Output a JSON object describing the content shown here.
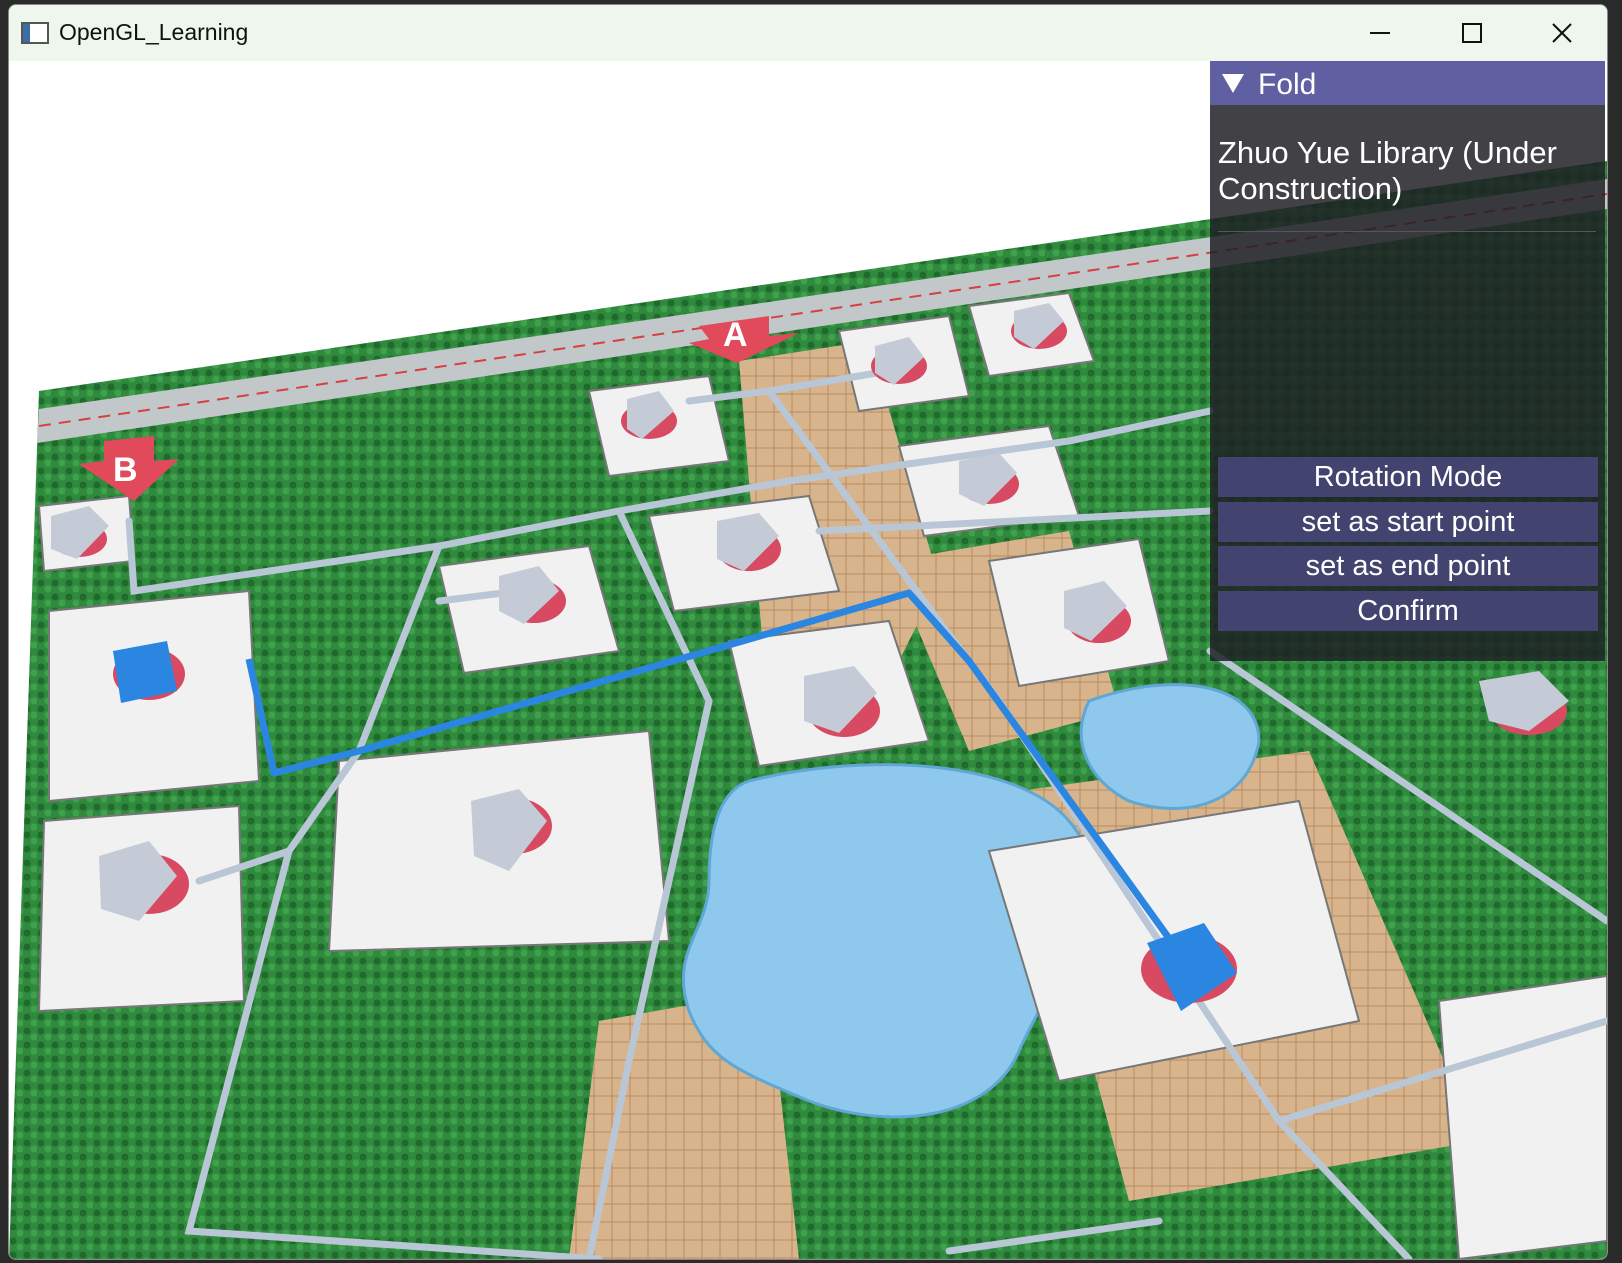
{
  "window": {
    "title": "OpenGL_Learning",
    "app_icon": "opengl-app-icon",
    "controls": [
      "minimize-icon",
      "maximize-icon",
      "close-icon"
    ]
  },
  "map": {
    "entrance_a": "A",
    "entrance_b": "B",
    "route_color": "#2a86e0",
    "road_color": "#b9c6d6",
    "water_color": "#8ec8ec",
    "grass_color": "#2f8a3e"
  },
  "panel": {
    "header_label": "Fold",
    "header_color": "#5f5fa2",
    "selected_place": "Zhuo Yue Library (Under Construction)",
    "buttons": {
      "rotation_mode": "Rotation Mode",
      "set_start": "set as start point",
      "set_end": "set as end point",
      "confirm": "Confirm"
    }
  }
}
